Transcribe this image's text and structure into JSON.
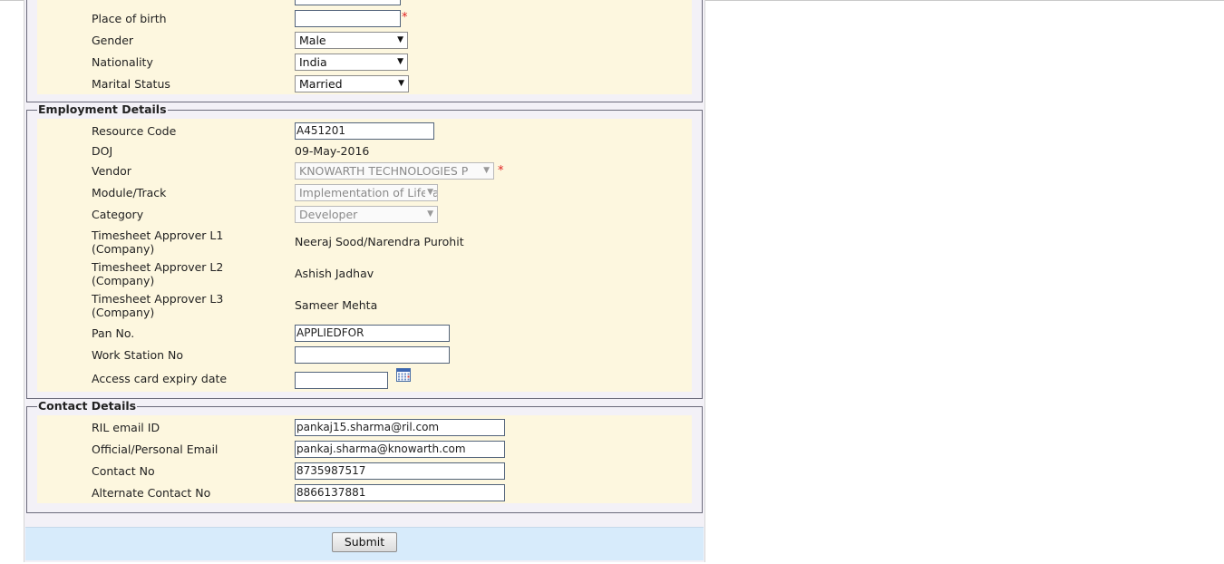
{
  "personal": {
    "place_of_birth": {
      "label": "Place of birth",
      "value": ""
    },
    "gender": {
      "label": "Gender",
      "value": "Male"
    },
    "nationality": {
      "label": "Nationality",
      "value": "India"
    },
    "marital_status": {
      "label": "Marital Status",
      "value": "Married"
    }
  },
  "employment": {
    "legend": "Employment Details",
    "resource_code": {
      "label": "Resource Code",
      "value": "A451201"
    },
    "doj": {
      "label": "DOJ",
      "value": "09-May-2016"
    },
    "vendor": {
      "label": "Vendor",
      "value": "KNOWARTH TECHNOLOGIES P"
    },
    "module": {
      "label": "Module/Track",
      "value": "Implementation of Lifera"
    },
    "category": {
      "label": "Category",
      "value": "Developer"
    },
    "approver_l1": {
      "label_1": "Timesheet Approver L1",
      "label_2": "(Company)",
      "value": "Neeraj Sood/Narendra Purohit"
    },
    "approver_l2": {
      "label_1": "Timesheet Approver L2",
      "label_2": "(Company)",
      "value": "Ashish Jadhav"
    },
    "approver_l3": {
      "label_1": "Timesheet Approver L3",
      "label_2": "(Company)",
      "value": "Sameer Mehta"
    },
    "pan": {
      "label": "Pan No.",
      "value": "APPLIEDFOR"
    },
    "workstation": {
      "label": "Work Station No",
      "value": ""
    },
    "access_card": {
      "label": "Access card expiry date",
      "value": ""
    }
  },
  "contact": {
    "legend": "Contact Details",
    "ril_email": {
      "label": "RIL email ID",
      "value": "pankaj15.sharma@ril.com"
    },
    "official_email": {
      "label": "Official/Personal Email",
      "value": "pankaj.sharma@knowarth.com"
    },
    "contact_no": {
      "label": "Contact No",
      "value": "8735987517"
    },
    "alt_contact_no": {
      "label": "Alternate Contact No",
      "value": "8866137881"
    }
  },
  "required_marker": "*",
  "dropdown_arrow": "▼",
  "submit_label": "Submit",
  "icons": {
    "calendar": "calendar-icon"
  }
}
